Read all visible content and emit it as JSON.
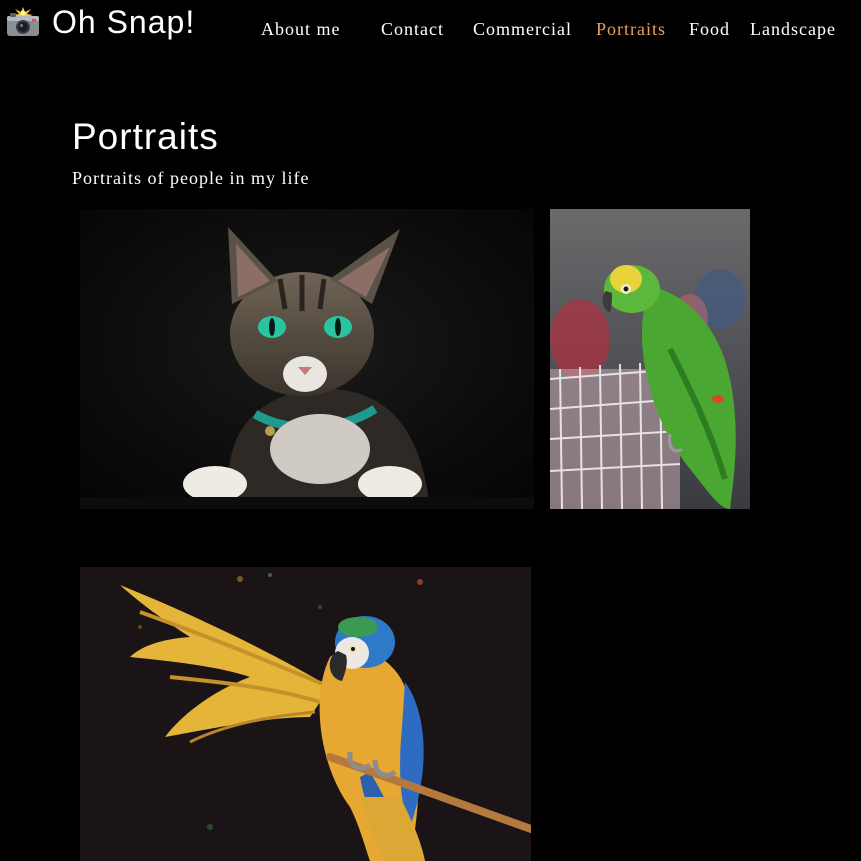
{
  "site": {
    "logo_text": "Oh Snap!",
    "logo_icon": "camera-flash-icon"
  },
  "nav": {
    "items": [
      {
        "label": "About me",
        "active": false
      },
      {
        "label": "Contact",
        "active": false
      },
      {
        "label": "Commercial",
        "active": false
      },
      {
        "label": "Portraits",
        "active": true
      },
      {
        "label": "Food",
        "active": false
      },
      {
        "label": "Landscape",
        "active": false
      }
    ]
  },
  "colors": {
    "background": "#000000",
    "text": "#ffffff",
    "nav_active": "#e8a25a"
  },
  "page": {
    "title": "Portraits",
    "subtitle": "Portraits of people in my life"
  },
  "gallery": {
    "photos": [
      {
        "subject": "tabby-cat-photo"
      },
      {
        "subject": "green-parrot-photo"
      },
      {
        "subject": "macaw-photo"
      }
    ]
  }
}
